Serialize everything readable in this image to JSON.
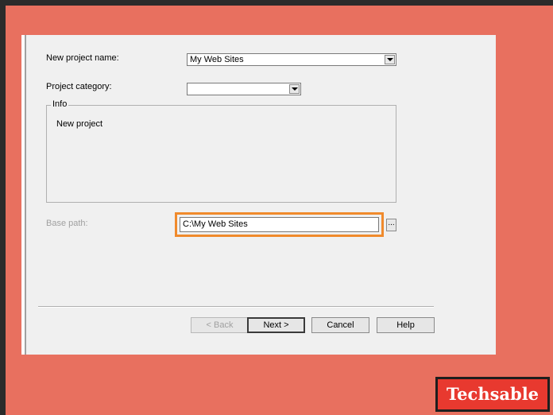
{
  "form": {
    "project_name_label": "New project name:",
    "project_name_value": "My Web Sites",
    "project_category_label": "Project category:",
    "project_category_value": "",
    "info_legend": "Info",
    "info_text": "New project",
    "base_path_label": "Base path:",
    "base_path_value": "C:\\My Web Sites",
    "browse_label": "..."
  },
  "buttons": {
    "back": "< Back",
    "next": "Next >",
    "cancel": "Cancel",
    "help": "Help"
  },
  "watermark": {
    "text": "Techsable"
  },
  "colors": {
    "background": "#e8705f",
    "highlight": "#f08a2c",
    "brand": "#e8392f"
  }
}
